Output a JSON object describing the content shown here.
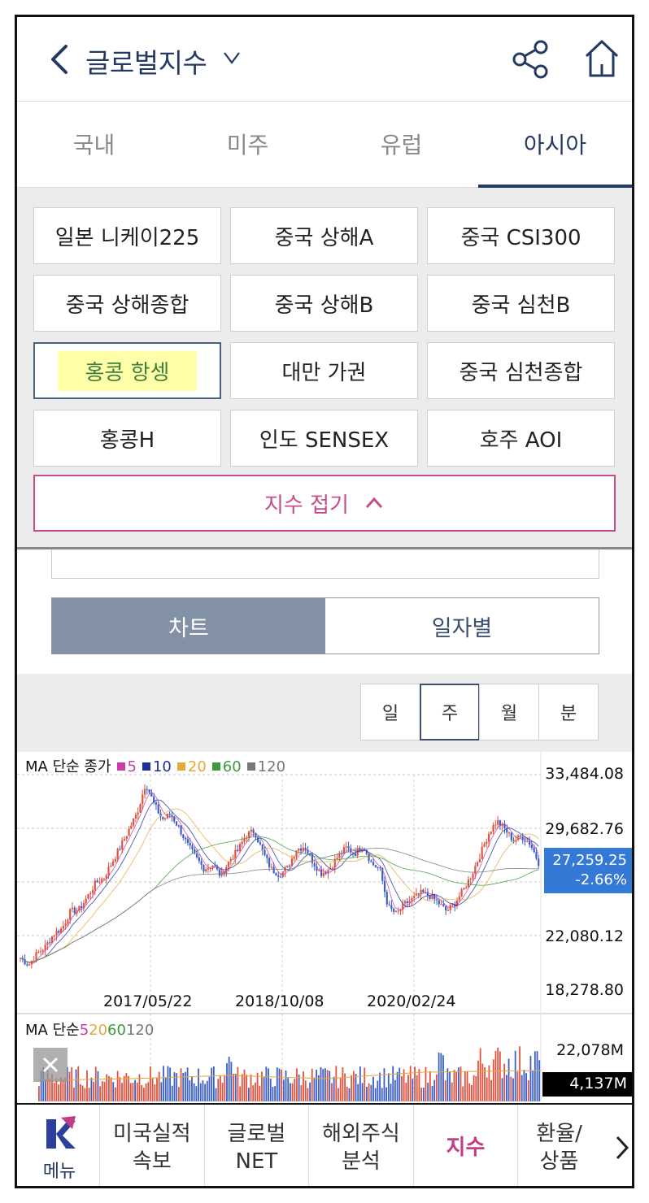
{
  "header": {
    "title": "글로벌지수"
  },
  "tabs": [
    {
      "label": "국내",
      "active": false
    },
    {
      "label": "미주",
      "active": false
    },
    {
      "label": "유럽",
      "active": false
    },
    {
      "label": "아시아",
      "active": true
    }
  ],
  "indices": [
    {
      "label": "일본 니케이225"
    },
    {
      "label": "중국 상해A"
    },
    {
      "label": "중국 CSI300"
    },
    {
      "label": "중국 상해종합"
    },
    {
      "label": "중국 상해B"
    },
    {
      "label": "중국 심천B"
    },
    {
      "label": "홍콩 항셍",
      "selected": true
    },
    {
      "label": "대만 가권"
    },
    {
      "label": "중국 심천종합"
    },
    {
      "label": "홍콩H"
    },
    {
      "label": "인도 SENSEX"
    },
    {
      "label": "호주 AOI"
    }
  ],
  "collapse_label": "지수 접기",
  "view_toggle": {
    "chart": "차트",
    "daily": "일자별"
  },
  "periods": [
    {
      "label": "일",
      "active": false
    },
    {
      "label": "주",
      "active": true
    },
    {
      "label": "월",
      "active": false
    },
    {
      "label": "분",
      "active": false
    }
  ],
  "colors": {
    "accent": "#243a63",
    "pink": "#c44d8a",
    "price_tag": "#3579d6",
    "up": "#e0533f",
    "down": "#3b5fc7"
  },
  "chart_data": [
    {
      "type": "candlestick",
      "legend": {
        "prefix": "MA 단순 종가",
        "items": [
          {
            "label": "5",
            "color": "#c63fa8"
          },
          {
            "label": "10",
            "color": "#1f2f9a"
          },
          {
            "label": "20",
            "color": "#e3a93a"
          },
          {
            "label": "60",
            "color": "#3c9a3c"
          },
          {
            "label": "120",
            "color": "#777777"
          }
        ]
      },
      "y_ticks": [
        "33,484.08",
        "29,682.76",
        "22,080.12",
        "18,278.80"
      ],
      "x_ticks": [
        "2017/05/22",
        "2018/10/08",
        "2020/02/24"
      ],
      "ylim": [
        18278.8,
        33484.08
      ],
      "last_price": "27,259.25",
      "last_change": "-2.66%",
      "close_series": [
        20500,
        20000,
        20800,
        21300,
        22200,
        22600,
        23800,
        23900,
        24800,
        25800,
        26200,
        27300,
        28400,
        29600,
        30800,
        32900,
        31400,
        30300,
        30700,
        29700,
        28500,
        27600,
        26800,
        27100,
        26300,
        27400,
        28100,
        29200,
        29500,
        28000,
        26800,
        26400,
        26900,
        28200,
        28400,
        27300,
        26500,
        26800,
        27700,
        28300,
        27900,
        28500,
        27200,
        26800,
        24100,
        23600,
        24300,
        24700,
        25100,
        24900,
        24400,
        23800,
        24400,
        25300,
        26400,
        27800,
        29300,
        30200,
        29600,
        28800,
        29100,
        28600,
        27259.25
      ]
    },
    {
      "type": "bar",
      "legend": {
        "prefix": "MA 단순",
        "items": [
          {
            "label": "5",
            "color": "#c63fa8"
          },
          {
            "label": "20",
            "color": "#e3a93a"
          },
          {
            "label": "60",
            "color": "#3c9a3c"
          },
          {
            "label": "120",
            "color": "#777777"
          }
        ]
      },
      "y_max_label": "22,078M",
      "last_label": "4,137M"
    }
  ],
  "bottom_nav": {
    "logo_label": "메뉴",
    "items": [
      {
        "line1": "미국실적",
        "line2": "속보"
      },
      {
        "line1": "글로벌",
        "line2": "NET"
      },
      {
        "line1": "해외주식",
        "line2": "분석"
      },
      {
        "line1": "지수",
        "line2": "",
        "active": true
      },
      {
        "line1": "환율/",
        "line2": "상품"
      }
    ]
  }
}
